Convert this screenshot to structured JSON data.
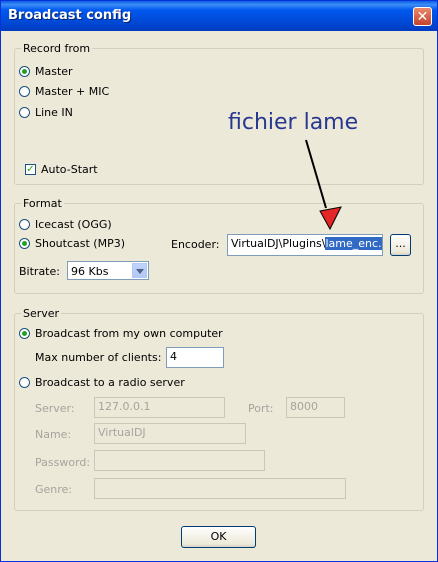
{
  "window": {
    "title": "Broadcast config"
  },
  "record_from": {
    "legend": "Record from",
    "options": [
      {
        "label": "Master",
        "selected": true
      },
      {
        "label": "Master + MIC",
        "selected": false
      },
      {
        "label": "Line IN",
        "selected": false
      }
    ],
    "auto_start": {
      "label": "Auto-Start",
      "checked": true
    }
  },
  "format": {
    "legend": "Format",
    "options": [
      {
        "label": "Icecast (OGG)",
        "selected": false
      },
      {
        "label": "Shoutcast (MP3)",
        "selected": true
      }
    ],
    "encoder_label": "Encoder:",
    "encoder_prefix": "VirtualDJ\\Plugins\\",
    "encoder_selected": "lame_enc.dll",
    "browse_label": "...",
    "bitrate_label": "Bitrate:",
    "bitrate_value": "96 Kbs"
  },
  "server": {
    "legend": "Server",
    "options": [
      {
        "label": "Broadcast from my own computer",
        "selected": true
      },
      {
        "label": "Broadcast to a radio server",
        "selected": false
      }
    ],
    "max_clients_label": "Max number of clients:",
    "max_clients_value": "4",
    "server_label": "Server:",
    "server_value": "127.0.0.1",
    "port_label": "Port:",
    "port_value": "8000",
    "name_label": "Name:",
    "name_value": "VirtualDJ",
    "password_label": "Password:",
    "password_value": "",
    "genre_label": "Genre:",
    "genre_value": ""
  },
  "ok_label": "OK",
  "annotation": {
    "text": "fichier lame",
    "color": "#283891",
    "arrow_color": "#e32626"
  },
  "colors": {
    "titlebar": "#0058ee",
    "dialog_bg": "#ece9d8",
    "selection": "#316ac5"
  }
}
